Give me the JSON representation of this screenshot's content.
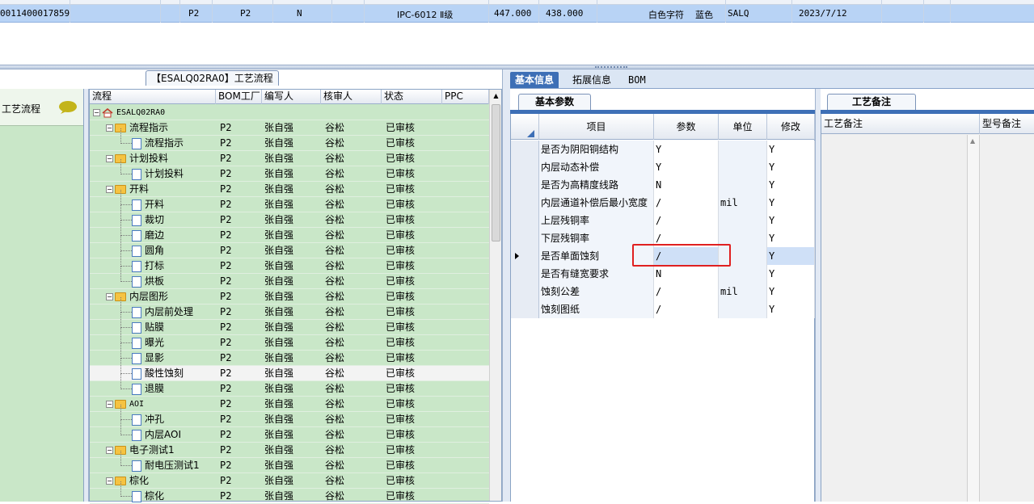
{
  "top_grid": {
    "row": {
      "order_no": "0011400017859",
      "c1": "P2",
      "c2": "P2",
      "c3": "N",
      "standard": "IPC-6012 Ⅱ级",
      "v1": "447.000",
      "v2": "438.000",
      "silk_color": "白色字符",
      "mask_color": "蓝色",
      "factory": "SALQ",
      "date": "2023/7/12"
    }
  },
  "left_panel": {
    "title": "工艺流程"
  },
  "process_tab": {
    "label": "【ESALQ02RA0】工艺流程"
  },
  "tree_grid": {
    "columns": [
      "流程",
      "BOM工厂",
      "编写人",
      "核审人",
      "状态",
      "PPC"
    ],
    "root": "ESALQ02RA0",
    "rows": [
      {
        "name": "流程指示",
        "type": "folder",
        "level": 1,
        "factory": "P2",
        "author": "张自强",
        "reviewer": "谷松",
        "status": "已审核"
      },
      {
        "name": "流程指示",
        "type": "doc",
        "level": 2,
        "factory": "P2",
        "author": "张自强",
        "reviewer": "谷松",
        "status": "已审核"
      },
      {
        "name": "计划投料",
        "type": "folder",
        "level": 1,
        "factory": "P2",
        "author": "张自强",
        "reviewer": "谷松",
        "status": "已审核"
      },
      {
        "name": "计划投料",
        "type": "doc",
        "level": 2,
        "factory": "P2",
        "author": "张自强",
        "reviewer": "谷松",
        "status": "已审核"
      },
      {
        "name": "开料",
        "type": "folder",
        "level": 1,
        "factory": "P2",
        "author": "张自强",
        "reviewer": "谷松",
        "status": "已审核"
      },
      {
        "name": "开料",
        "type": "doc",
        "level": 2,
        "factory": "P2",
        "author": "张自强",
        "reviewer": "谷松",
        "status": "已审核"
      },
      {
        "name": "裁切",
        "type": "doc",
        "level": 2,
        "factory": "P2",
        "author": "张自强",
        "reviewer": "谷松",
        "status": "已审核"
      },
      {
        "name": "磨边",
        "type": "doc",
        "level": 2,
        "factory": "P2",
        "author": "张自强",
        "reviewer": "谷松",
        "status": "已审核"
      },
      {
        "name": "圆角",
        "type": "doc",
        "level": 2,
        "factory": "P2",
        "author": "张自强",
        "reviewer": "谷松",
        "status": "已审核"
      },
      {
        "name": "打标",
        "type": "doc",
        "level": 2,
        "factory": "P2",
        "author": "张自强",
        "reviewer": "谷松",
        "status": "已审核"
      },
      {
        "name": "烘板",
        "type": "doc",
        "level": 2,
        "factory": "P2",
        "author": "张自强",
        "reviewer": "谷松",
        "status": "已审核"
      },
      {
        "name": "内层图形",
        "type": "folder",
        "level": 1,
        "factory": "P2",
        "author": "张自强",
        "reviewer": "谷松",
        "status": "已审核"
      },
      {
        "name": "内层前处理",
        "type": "doc",
        "level": 2,
        "factory": "P2",
        "author": "张自强",
        "reviewer": "谷松",
        "status": "已审核"
      },
      {
        "name": "贴膜",
        "type": "doc",
        "level": 2,
        "factory": "P2",
        "author": "张自强",
        "reviewer": "谷松",
        "status": "已审核"
      },
      {
        "name": "曝光",
        "type": "doc",
        "level": 2,
        "factory": "P2",
        "author": "张自强",
        "reviewer": "谷松",
        "status": "已审核"
      },
      {
        "name": "显影",
        "type": "doc",
        "level": 2,
        "factory": "P2",
        "author": "张自强",
        "reviewer": "谷松",
        "status": "已审核"
      },
      {
        "name": "酸性蚀刻",
        "type": "doc",
        "level": 2,
        "factory": "P2",
        "author": "张自强",
        "reviewer": "谷松",
        "status": "已审核",
        "selected": true
      },
      {
        "name": "退膜",
        "type": "doc",
        "level": 2,
        "factory": "P2",
        "author": "张自强",
        "reviewer": "谷松",
        "status": "已审核"
      },
      {
        "name": "AOI",
        "type": "folder",
        "level": 1,
        "factory": "P2",
        "author": "张自强",
        "reviewer": "谷松",
        "status": "已审核"
      },
      {
        "name": "冲孔",
        "type": "doc",
        "level": 2,
        "factory": "P2",
        "author": "张自强",
        "reviewer": "谷松",
        "status": "已审核"
      },
      {
        "name": "内层AOI",
        "type": "doc",
        "level": 2,
        "factory": "P2",
        "author": "张自强",
        "reviewer": "谷松",
        "status": "已审核"
      },
      {
        "name": "电子测试1",
        "type": "folder",
        "level": 1,
        "factory": "P2",
        "author": "张自强",
        "reviewer": "谷松",
        "status": "已审核"
      },
      {
        "name": "耐电压测试1",
        "type": "doc",
        "level": 2,
        "factory": "P2",
        "author": "张自强",
        "reviewer": "谷松",
        "status": "已审核"
      },
      {
        "name": "棕化",
        "type": "folder",
        "level": 1,
        "factory": "P2",
        "author": "张自强",
        "reviewer": "谷松",
        "status": "已审核"
      },
      {
        "name": "棕化",
        "type": "doc",
        "level": 2,
        "factory": "P2",
        "author": "张自强",
        "reviewer": "谷松",
        "status": "已审核"
      }
    ]
  },
  "tabs": [
    "基本信息",
    "拓展信息",
    "BOM"
  ],
  "params": {
    "subtab": "基本参数",
    "columns": [
      "项目",
      "参数",
      "单位",
      "修改"
    ],
    "rows": [
      {
        "item": "是否为阴阳铜结构",
        "value": "Y",
        "unit": "",
        "modify": "Y"
      },
      {
        "item": "内层动态补偿",
        "value": "Y",
        "unit": "",
        "modify": "Y"
      },
      {
        "item": "是否为高精度线路",
        "value": "N",
        "unit": "",
        "modify": "Y"
      },
      {
        "item": "内层通道补偿后最小宽度",
        "value": "/",
        "unit": "mil",
        "modify": "Y"
      },
      {
        "item": "上层残铜率",
        "value": "/",
        "unit": "",
        "modify": "Y"
      },
      {
        "item": "下层残铜率",
        "value": "/",
        "unit": "",
        "modify": "Y"
      },
      {
        "item": "是否单面蚀刻",
        "value": "/",
        "unit": "",
        "modify": "Y",
        "selected": true
      },
      {
        "item": "是否有缝宽要求",
        "value": "N",
        "unit": "",
        "modify": "Y"
      },
      {
        "item": "蚀刻公差",
        "value": "/",
        "unit": "mil",
        "modify": "Y"
      },
      {
        "item": "蚀刻图纸",
        "value": "/",
        "unit": "",
        "modify": "Y"
      }
    ]
  },
  "remarks": {
    "subtab": "工艺备注",
    "columns": [
      "工艺备注",
      "型号备注"
    ]
  },
  "colors": {
    "accent": "#3d6fb6",
    "tree_bg": "#c9e7c8",
    "highlight": "#e02020",
    "selected_row": "#b8d3f5"
  }
}
